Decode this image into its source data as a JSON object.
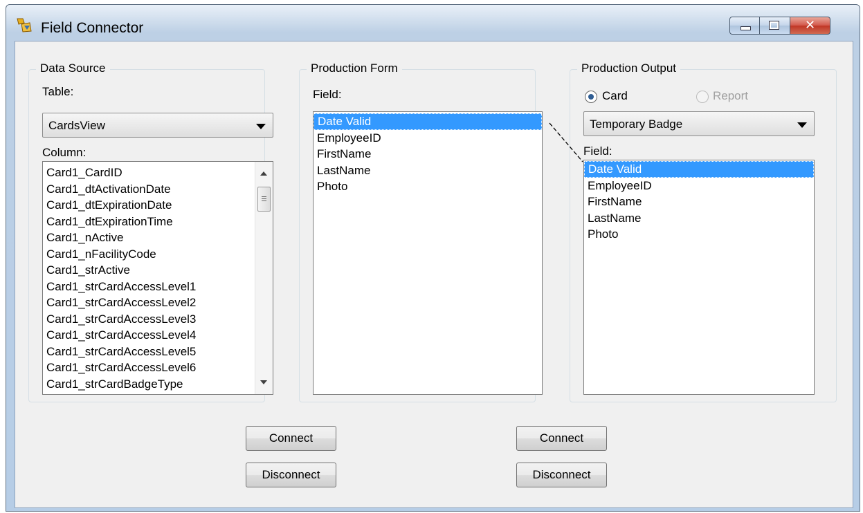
{
  "window": {
    "title": "Field Connector"
  },
  "data_source": {
    "group_title": "Data Source",
    "table_label": "Table:",
    "table_selected": "CardsView",
    "column_label": "Column:",
    "columns": [
      "Card1_CardID",
      "Card1_dtActivationDate",
      "Card1_dtExpirationDate",
      "Card1_dtExpirationTime",
      "Card1_nActive",
      "Card1_nFacilityCode",
      "Card1_strActive",
      "Card1_strCardAccessLevel1",
      "Card1_strCardAccessLevel2",
      "Card1_strCardAccessLevel3",
      "Card1_strCardAccessLevel4",
      "Card1_strCardAccessLevel5",
      "Card1_strCardAccessLevel6",
      "Card1_strCardBadgeType"
    ]
  },
  "production_form": {
    "group_title": "Production Form",
    "field_label": "Field:",
    "fields": [
      "Date Valid",
      "EmployeeID",
      "FirstName",
      "LastName",
      "Photo"
    ],
    "selected_index": 0
  },
  "production_output": {
    "group_title": "Production Output",
    "radio_card": "Card",
    "radio_report": "Report",
    "selected_radio": "Card",
    "template_selected": "Temporary Badge",
    "field_label": "Field:",
    "fields": [
      "Date Valid",
      "EmployeeID",
      "FirstName",
      "LastName",
      "Photo"
    ],
    "selected_index": 0
  },
  "buttons": {
    "connect_left": "Connect",
    "disconnect_left": "Disconnect",
    "connect_right": "Connect",
    "disconnect_right": "Disconnect"
  },
  "colors": {
    "selection": "#3399ff",
    "client_bg": "#f0f0f0",
    "close_button": "#c03626"
  }
}
